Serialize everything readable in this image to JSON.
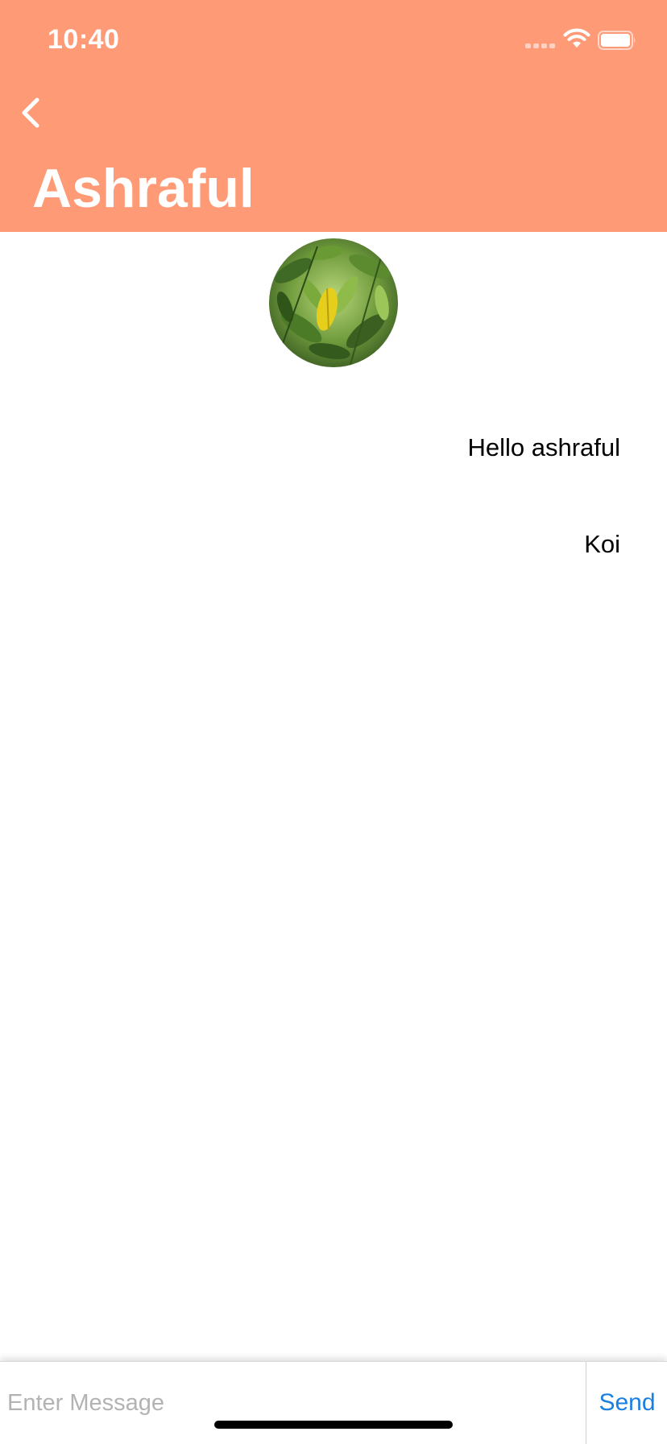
{
  "status_bar": {
    "time": "10:40",
    "signal_icon": "cellular-signal-icon",
    "wifi_icon": "wifi-icon",
    "battery_icon": "battery-icon"
  },
  "nav": {
    "back_icon": "chevron-left-icon",
    "title": "Ashraful"
  },
  "profile": {
    "avatar_icon": "profile-photo"
  },
  "messages": [
    {
      "text": "Hello ashraful"
    },
    {
      "text": "Koi"
    }
  ],
  "composer": {
    "placeholder": "Enter Message",
    "value": "",
    "send_label": "Send"
  },
  "colors": {
    "header_background": "#ff9a76",
    "send_accent": "#1a7fe0",
    "placeholder": "#b3b3b3"
  }
}
